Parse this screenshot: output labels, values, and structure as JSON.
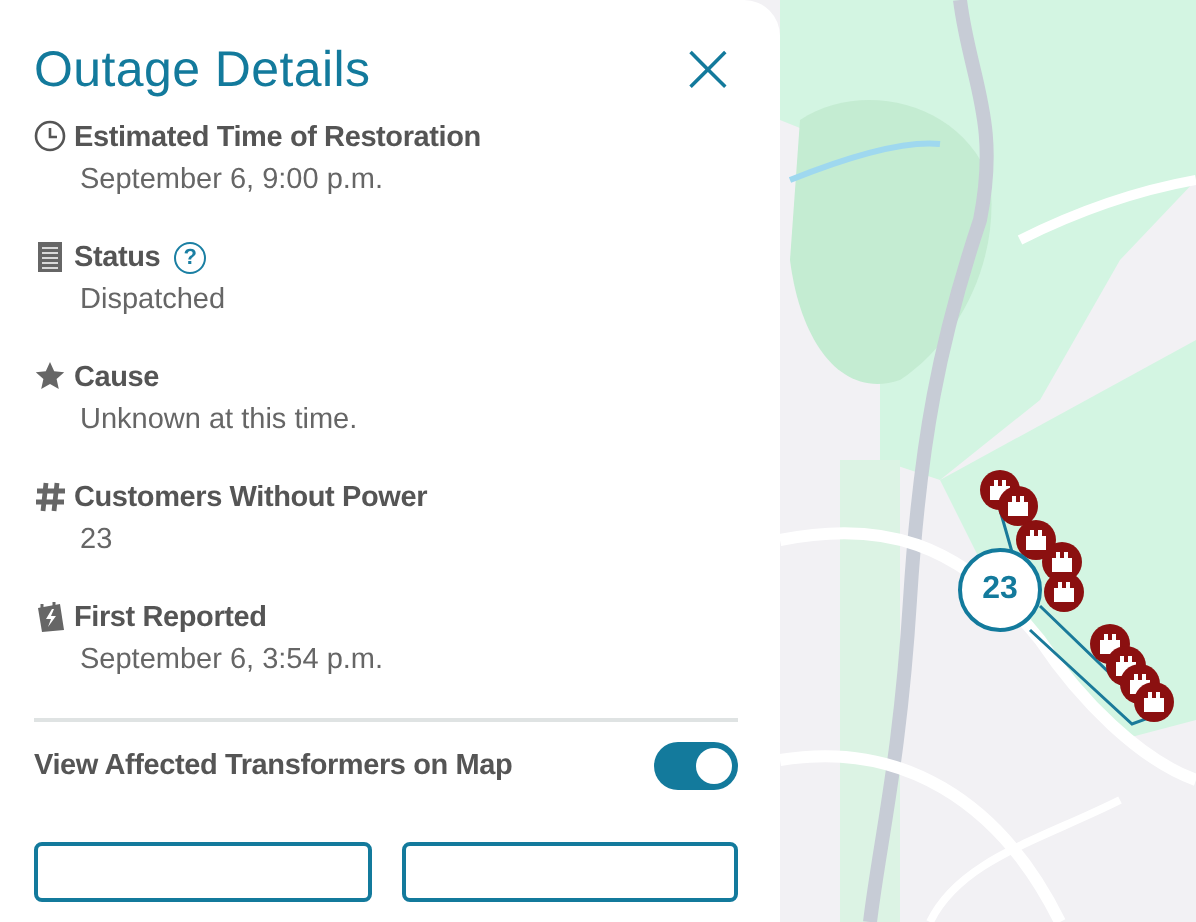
{
  "panel": {
    "title": "Outage Details",
    "close": "×"
  },
  "details": [
    {
      "kind": "clock",
      "label": "Estimated Time of Restoration",
      "value": "September 6, 9:00 p.m."
    },
    {
      "kind": "status",
      "label": "Status",
      "help": "?",
      "value": "Dispatched"
    },
    {
      "kind": "star",
      "label": "Cause",
      "value": "Unknown at this time."
    },
    {
      "kind": "hash",
      "label": "Customers Without Power",
      "value": "23"
    },
    {
      "kind": "calendar",
      "label": "First Reported",
      "value": "September 6, 3:54 p.m."
    }
  ],
  "toggle": {
    "label": "View Affected Transformers on Map",
    "on": true
  },
  "buttons": [
    {
      "kind": "outline"
    },
    {
      "kind": "outline"
    }
  ],
  "map": {
    "kind": "picture",
    "cluster": {
      "count": "23"
    }
  }
}
